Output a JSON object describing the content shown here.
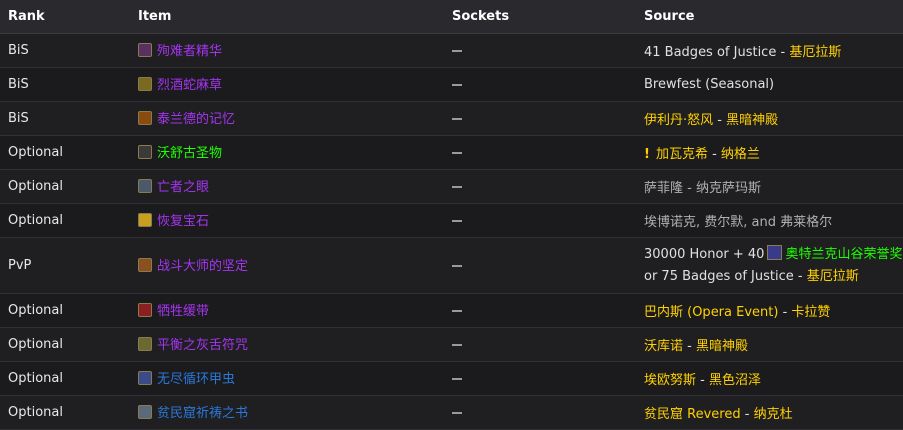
{
  "headers": {
    "rank": "Rank",
    "item": "Item",
    "sockets": "Sockets",
    "source": "Source"
  },
  "rows": [
    {
      "rank": "BiS",
      "item": "殉难者精华",
      "icon_color": "#5a3060",
      "src1": "41 Badges of Justice",
      "sep": " - ",
      "src2": "基厄拉斯"
    },
    {
      "rank": "BiS",
      "item": "烈酒蛇麻草",
      "icon_color": "#7a6a20",
      "src1": "Brewfest (Seasonal)"
    },
    {
      "rank": "BiS",
      "item": "泰兰德的记忆",
      "icon_color": "#8a4a10",
      "src1": "伊利丹·怒风",
      "sep": " - ",
      "src2": "黑暗神殿"
    },
    {
      "rank": "Optional",
      "item": "沃舒古圣物",
      "icon_color": "#3a3a3a",
      "quest": "!",
      "src1": "加瓦克希",
      "sep": " - ",
      "src2": "纳格兰"
    },
    {
      "rank": "Optional",
      "item": "亡者之眼",
      "icon_color": "#4a5a6a",
      "src1": "萨菲隆",
      "sep": " - ",
      "src2": "纳克萨玛斯"
    },
    {
      "rank": "Optional",
      "item": "恢复宝石",
      "icon_color": "#c8a020",
      "src1": "埃博诺克, 费尔默, and 弗莱格尔"
    },
    {
      "rank": "PvP",
      "item": "战斗大师的坚定",
      "icon_color": "#8a5020",
      "src1": "30000 Honor + 40",
      "src1b": "奥特兰克山谷荣誉奖章",
      "src3": "or 75 Badges of Justice",
      "sep": " - ",
      "src2": "基厄拉斯"
    },
    {
      "rank": "Optional",
      "item": "牺牲缓带",
      "icon_color": "#8a2020",
      "src1": "巴内斯 (Opera Event)",
      "sep": " - ",
      "src2": "卡拉赞"
    },
    {
      "rank": "Optional",
      "item": "平衡之灰舌符咒",
      "icon_color": "#6a6a30",
      "src1": "沃库诺",
      "sep": " - ",
      "src2": "黑暗神殿"
    },
    {
      "rank": "Optional",
      "item": "无尽循环甲虫",
      "icon_color": "#3a4a8a",
      "src1": "埃欧努斯",
      "sep": " - ",
      "src2": "黑色沼泽"
    },
    {
      "rank": "Optional",
      "item": "贫民窟祈祷之书",
      "icon_color": "#5a6a7a",
      "src1": "贫民窟 Revered",
      "sep": " - ",
      "src2": "纳克杜"
    }
  ]
}
